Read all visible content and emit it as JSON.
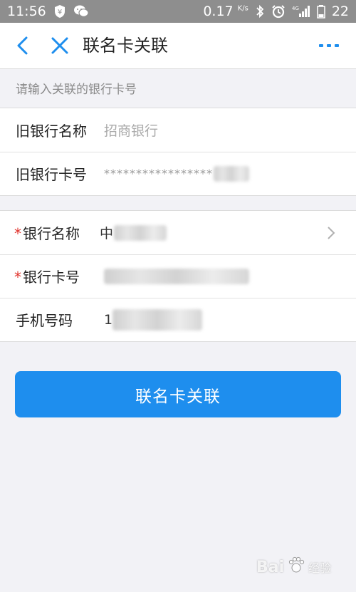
{
  "status_bar": {
    "time": "11:56",
    "net_speed": "0.17",
    "net_speed_unit": "K/s",
    "signal_label": "4G",
    "battery": "22"
  },
  "header": {
    "title": "联名卡关联"
  },
  "form": {
    "hint": "请输入关联的银行卡号",
    "old_bank_name": {
      "label": "旧银行名称",
      "value": "招商银行"
    },
    "old_card_no": {
      "label": "旧银行卡号",
      "value": "*****************"
    },
    "bank_name": {
      "required_mark": "*",
      "label": "银行名称",
      "value": "中"
    },
    "card_no": {
      "required_mark": "*",
      "label": "银行卡号"
    },
    "phone": {
      "label": "手机号码",
      "value": "1"
    }
  },
  "submit": {
    "label": "联名卡关联"
  },
  "watermark": {
    "brand": "Bai",
    "suffix": "经验"
  },
  "colors": {
    "accent": "#1e8eee",
    "required": "#e0302a",
    "status_bar": "#8e8e8e"
  },
  "icons": [
    "shield-yen-icon",
    "wechat-icon",
    "bluetooth-icon",
    "alarm-icon",
    "signal-icon",
    "battery-icon",
    "back-arrow-icon",
    "close-icon",
    "more-icon",
    "chevron-right-icon",
    "paw-icon"
  ]
}
